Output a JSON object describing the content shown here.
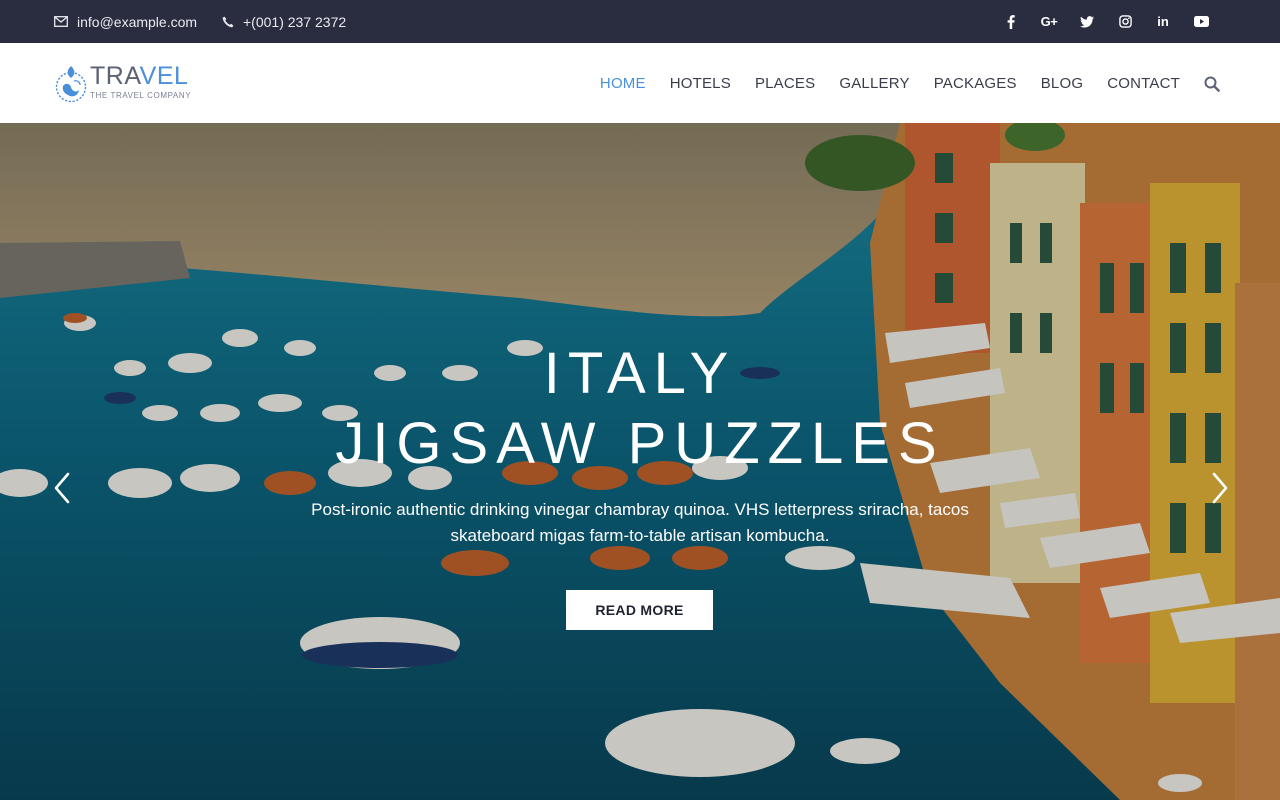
{
  "topbar": {
    "email": "info@example.com",
    "phone": "+(001) 237 2372",
    "socials": [
      {
        "name": "facebook-icon",
        "glyph": "f"
      },
      {
        "name": "google-plus-icon",
        "glyph": "G+"
      },
      {
        "name": "twitter-icon",
        "glyph": ""
      },
      {
        "name": "instagram-icon",
        "glyph": ""
      },
      {
        "name": "linkedin-icon",
        "glyph": "in"
      },
      {
        "name": "youtube-icon",
        "glyph": ""
      }
    ]
  },
  "header": {
    "logo": {
      "name_prefix": "TRA",
      "name_accent": "VEL",
      "tagline": "THE TRAVEL COMPANY"
    },
    "nav": [
      {
        "label": "HOME",
        "active": true
      },
      {
        "label": "HOTELS",
        "active": false
      },
      {
        "label": "PLACES",
        "active": false
      },
      {
        "label": "GALLERY",
        "active": false
      },
      {
        "label": "PACKAGES",
        "active": false
      },
      {
        "label": "BLOG",
        "active": false
      },
      {
        "label": "CONTACT",
        "active": false
      }
    ]
  },
  "hero": {
    "title_line1": "ITALY",
    "title_line2": "JIGSAW PUZZLES",
    "description": "Post-ironic authentic drinking vinegar chambray quinoa. VHS letterpress sriracha, tacos skateboard migas farm-to-table artisan kombucha.",
    "button_label": "READ MORE"
  },
  "colors": {
    "topbar_bg": "#2a2d40",
    "accent": "#4a90d9",
    "nav_text": "#3a3d4a"
  }
}
